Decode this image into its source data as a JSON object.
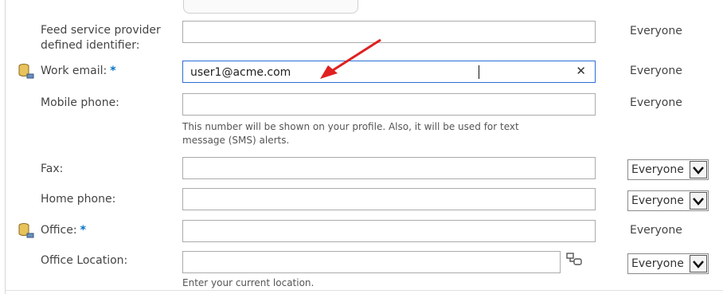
{
  "fields": {
    "feed_id": {
      "label_line1": "Feed service provider",
      "label_line2": "defined identifier:",
      "value": "",
      "visibility": "Everyone"
    },
    "work_email": {
      "label": "Work email:",
      "required_mark": "*",
      "value": "user1@acme.com",
      "clear_glyph": "✕",
      "visibility": "Everyone",
      "icon": "directory-sync-icon"
    },
    "mobile_phone": {
      "label": "Mobile phone:",
      "value": "",
      "visibility": "Everyone",
      "hint_line1": "This number will be shown on your profile. Also, it will be used for text",
      "hint_line2": "message (SMS) alerts."
    },
    "fax": {
      "label": "Fax:",
      "value": "",
      "visibility": "Everyone"
    },
    "home_phone": {
      "label": "Home phone:",
      "value": "",
      "visibility": "Everyone"
    },
    "office": {
      "label": "Office:",
      "required_mark": "*",
      "value": "",
      "visibility": "Everyone",
      "icon": "directory-sync-icon"
    },
    "office_location": {
      "label": "Office Location:",
      "value": "",
      "visibility": "Everyone",
      "hint": "Enter your current location.",
      "icon": "location-picker-icon"
    }
  },
  "colors": {
    "accent": "#0072c6",
    "focus_border": "#2b6fd6",
    "annotation_arrow": "#e02020"
  }
}
